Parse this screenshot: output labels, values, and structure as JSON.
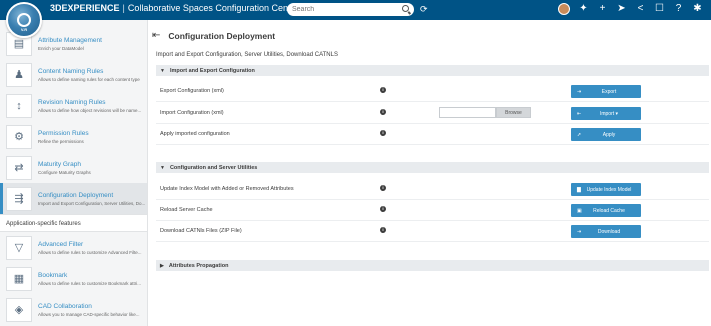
{
  "topbar": {
    "brand": "3DEXPERIENCE",
    "app_title": "Collaborative Spaces Configuration Center - SOLIDWORKS PM Te...",
    "search_placeholder": "Search",
    "compass_label": "V.R"
  },
  "sidebar": {
    "items": [
      {
        "title": "Attribute Management",
        "sub": "Enrich your DataModel"
      },
      {
        "title": "Content Naming Rules",
        "sub": "Allows to define naming rules for each content type"
      },
      {
        "title": "Revision Naming Rules",
        "sub": "Allows to define how object revisions will be name..."
      },
      {
        "title": "Permission Rules",
        "sub": "Refine the permissions"
      },
      {
        "title": "Maturity Graph",
        "sub": "Configure Maturity Graphs"
      },
      {
        "title": "Configuration Deployment",
        "sub": "Import and Export Configuration, Server Utilities, Do..."
      }
    ],
    "section_label": "Application-specific features",
    "app_items": [
      {
        "title": "Advanced Filter",
        "sub": "Allows to define rules to customize Advanced Filte..."
      },
      {
        "title": "Bookmark",
        "sub": "Allows to define rules to customize Bookmark attri..."
      },
      {
        "title": "CAD Collaboration",
        "sub": "Allows you to manage CAD-specific behavior like..."
      }
    ]
  },
  "main": {
    "title": "Configuration Deployment",
    "subtitle": "Import and Export Configuration, Server Utilities, Download CATNLS",
    "sections": [
      {
        "label": "Import and Export Configuration",
        "rows": [
          {
            "label": "Export Configuration (xml)",
            "button": "Export"
          },
          {
            "label": "Import Configuration (xml)",
            "button": "Import",
            "browse": "Browse"
          },
          {
            "label": "Apply imported configuration",
            "button": "Apply"
          }
        ]
      },
      {
        "label": "Configuration and Server Utilities",
        "rows": [
          {
            "label": "Update Index Model with Added or Removed Attributes",
            "button": "Update Index Model"
          },
          {
            "label": "Reload Server Cache",
            "button": "Reload Cache"
          },
          {
            "label": "Download CATNls Files (ZIP File)",
            "button": "Download"
          }
        ]
      },
      {
        "label": "Attributes Propagation",
        "rows": []
      }
    ]
  },
  "colors": {
    "topbar": "#005386",
    "accent": "#368ec4",
    "section_bg": "#e8ebee"
  }
}
